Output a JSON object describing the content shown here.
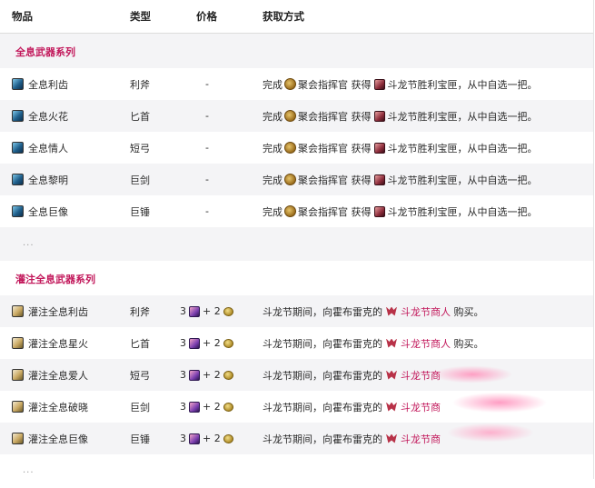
{
  "header": {
    "item": "物品",
    "type": "类型",
    "price": "价格",
    "source": "获取方式"
  },
  "sections": [
    {
      "title": "全息武器系列",
      "rows": [
        {
          "name": "全息利齿",
          "type": "利斧",
          "price": "-",
          "src_a": "完成",
          "src_b": "聚会指挥官",
          "src_c": "获得",
          "src_d": "斗龙节胜利宝匣",
          "src_e": "，从中自选一把。"
        },
        {
          "name": "全息火花",
          "type": "匕首",
          "price": "-",
          "src_a": "完成",
          "src_b": "聚会指挥官",
          "src_c": "获得",
          "src_d": "斗龙节胜利宝匣",
          "src_e": "，从中自选一把。"
        },
        {
          "name": "全息情人",
          "type": "短弓",
          "price": "-",
          "src_a": "完成",
          "src_b": "聚会指挥官",
          "src_c": "获得",
          "src_d": "斗龙节胜利宝匣",
          "src_e": "，从中自选一把。"
        },
        {
          "name": "全息黎明",
          "type": "巨剑",
          "price": "-",
          "src_a": "完成",
          "src_b": "聚会指挥官",
          "src_c": "获得",
          "src_d": "斗龙节胜利宝匣",
          "src_e": "，从中自选一把。"
        },
        {
          "name": "全息巨像",
          "type": "巨锤",
          "price": "-",
          "src_a": "完成",
          "src_b": "聚会指挥官",
          "src_c": "获得",
          "src_d": "斗龙节胜利宝匣",
          "src_e": "，从中自选一把。"
        }
      ],
      "ellipsis": "..."
    },
    {
      "title": "灌注全息武器系列",
      "rows": [
        {
          "name": "灌注全息利齿",
          "type": "利斧",
          "price_a": "3",
          "price_b": "+ 2",
          "src_a": "斗龙节期间，向霍布雷克的",
          "src_b": "斗龙节商人",
          "src_c": "购买。"
        },
        {
          "name": "灌注全息星火",
          "type": "匕首",
          "price_a": "3",
          "price_b": "+ 2",
          "src_a": "斗龙节期间，向霍布雷克的",
          "src_b": "斗龙节商人",
          "src_c": "购买。"
        },
        {
          "name": "灌注全息爱人",
          "type": "短弓",
          "price_a": "3",
          "price_b": "+ 2",
          "src_a": "斗龙节期间，向霍布雷克的",
          "src_b": "斗龙节商",
          "src_c": ""
        },
        {
          "name": "灌注全息破晓",
          "type": "巨剑",
          "price_a": "3",
          "price_b": "+ 2",
          "src_a": "斗龙节期间，向霍布雷克的",
          "src_b": "斗龙节商",
          "src_c": ""
        },
        {
          "name": "灌注全息巨像",
          "type": "巨锤",
          "price_a": "3",
          "price_b": "+ 2",
          "src_a": "斗龙节期间，向霍布雷克的",
          "src_b": "斗龙节商",
          "src_c": ""
        }
      ],
      "ellipsis": "..."
    }
  ],
  "icons": {
    "weapon": "holo-weapon-icon",
    "infused": "infused-weapon-icon",
    "commander": "commander-badge-icon",
    "chest": "victory-chest-icon",
    "token": "festival-token-icon",
    "coin": "gold-coin-icon",
    "merchant": "merchant-icon"
  },
  "colors": {
    "section_title": "#c2185b",
    "link": "#c2185b",
    "row_alt": "#f4f4f6"
  }
}
